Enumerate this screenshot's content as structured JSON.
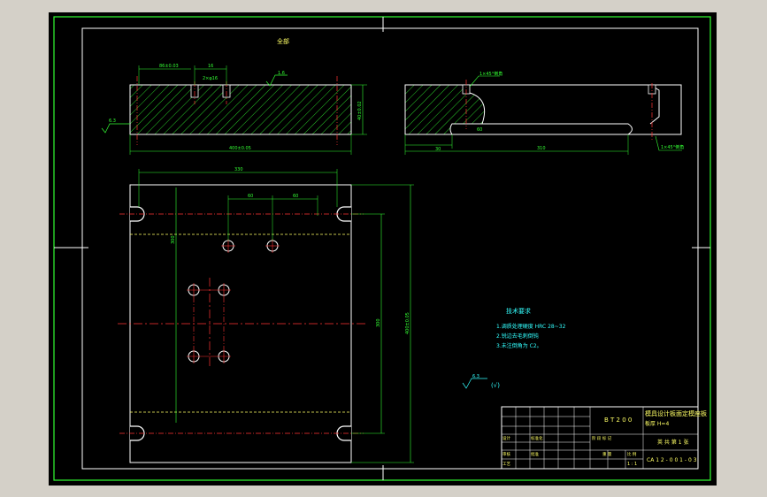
{
  "colors": {
    "frame": "#33ff33",
    "outline": "#ffffff",
    "dimension": "#33ff33",
    "hatch": "#33ff33",
    "centerline": "#ff3333",
    "hidden": "#ffff66",
    "notes": "#33ffff",
    "title_text": "#ffff66"
  },
  "views": {
    "top_note": "全部",
    "front_view": {
      "dims": {
        "left_pos": "86±0.03",
        "hole_spacing": "16",
        "hole_spec": "2×φ16",
        "height": "40±0.02",
        "width": "400±0.05",
        "roughness_top": "1.6",
        "roughness_side": "6.3"
      }
    },
    "side_view": {
      "dims": {
        "top_chamfer": "1×45°倒角",
        "bottom_chamfer": "1×45°倒角",
        "depth": "30",
        "length": "310",
        "small": "60"
      }
    },
    "plan_view": {
      "dims": {
        "overall_top": "330",
        "hole_offset_1": "60",
        "hole_offset_2": "60",
        "inner_vertical": "300",
        "outer_vertical": "400±0.05",
        "left_vertical": "300"
      }
    }
  },
  "notes": {
    "heading": "技术要求",
    "items": [
      "1.调质处理硬度 HRC 28~32",
      "2.锐边去毛刺倒钝",
      "3.未注倒角为 C2。"
    ],
    "roughness_general": "6.3",
    "roughness_mark": "(√)"
  },
  "title_block": {
    "drawing_no": "B T 2 0 0",
    "part_name_line1": "模具设计板面定模座板",
    "part_name_line2": "板厚 H=4",
    "material": "英 共 第 1 张",
    "code": "CA 1 2 - 0 0 1 - 0 3",
    "row_labels": [
      "设计",
      "标准化",
      "审核",
      "工艺",
      "批准"
    ],
    "scale_labels": [
      "阶 段 标 记",
      "重 量",
      "比 例"
    ],
    "scale_values": [
      "1 : 1"
    ]
  }
}
